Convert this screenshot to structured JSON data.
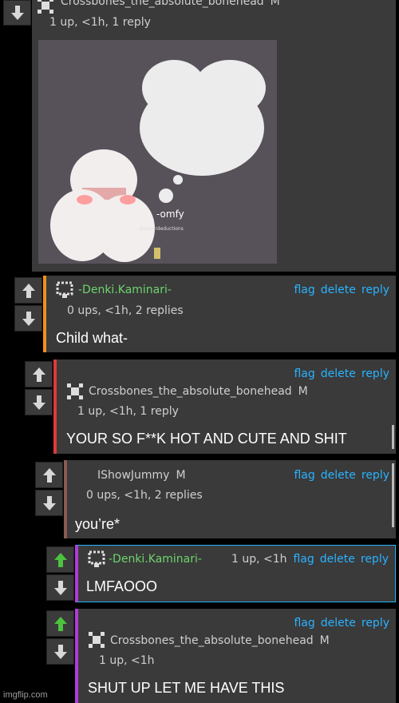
{
  "colors": {
    "accent": "#29b3ff",
    "upvote": "#4cc23f",
    "card": "#3a3a3a"
  },
  "top": {
    "username": "Crossbones_the_absolute_bonehead",
    "mod": "M",
    "meta": "1 up, <1h, 1 reply",
    "image_caption": "-omfy",
    "image_credit": "@superdeductions"
  },
  "comments": [
    {
      "username": "-Denki.Kaminari-",
      "mod": "",
      "meta": "0 ups, <1h, 2 replies",
      "body": "Child what-",
      "actions": [
        "flag",
        "delete",
        "reply"
      ],
      "bar": "#f0901a"
    },
    {
      "username": "Crossbones_the_absolute_bonehead",
      "mod": "M",
      "meta": "1 up, <1h, 1 reply",
      "body": "YOUR SO F**K HOT AND CUTE AND SHIT",
      "actions": [
        "flag",
        "delete",
        "reply"
      ],
      "bar": "#e03a3a"
    },
    {
      "username": "IShowJummy",
      "mod": "M",
      "meta": "0 ups, <1h, 2 replies",
      "body": "you’re*",
      "actions": [
        "flag",
        "delete",
        "reply"
      ],
      "bar": "#8a5a52"
    },
    {
      "username": "-Denki.Kaminari-",
      "mod": "",
      "meta": "1 up, <1h",
      "body": "LMFAOOO",
      "actions": [
        "flag",
        "delete",
        "reply"
      ],
      "bar": "#b23bd8"
    },
    {
      "username": "Crossbones_the_absolute_bonehead",
      "mod": "M",
      "meta": "1 up, <1h",
      "body": "SHUT UP LET ME HAVE THIS",
      "actions": [
        "flag",
        "delete",
        "reply"
      ],
      "bar": "#b23bd8"
    }
  ],
  "footer": "imgflip.com"
}
